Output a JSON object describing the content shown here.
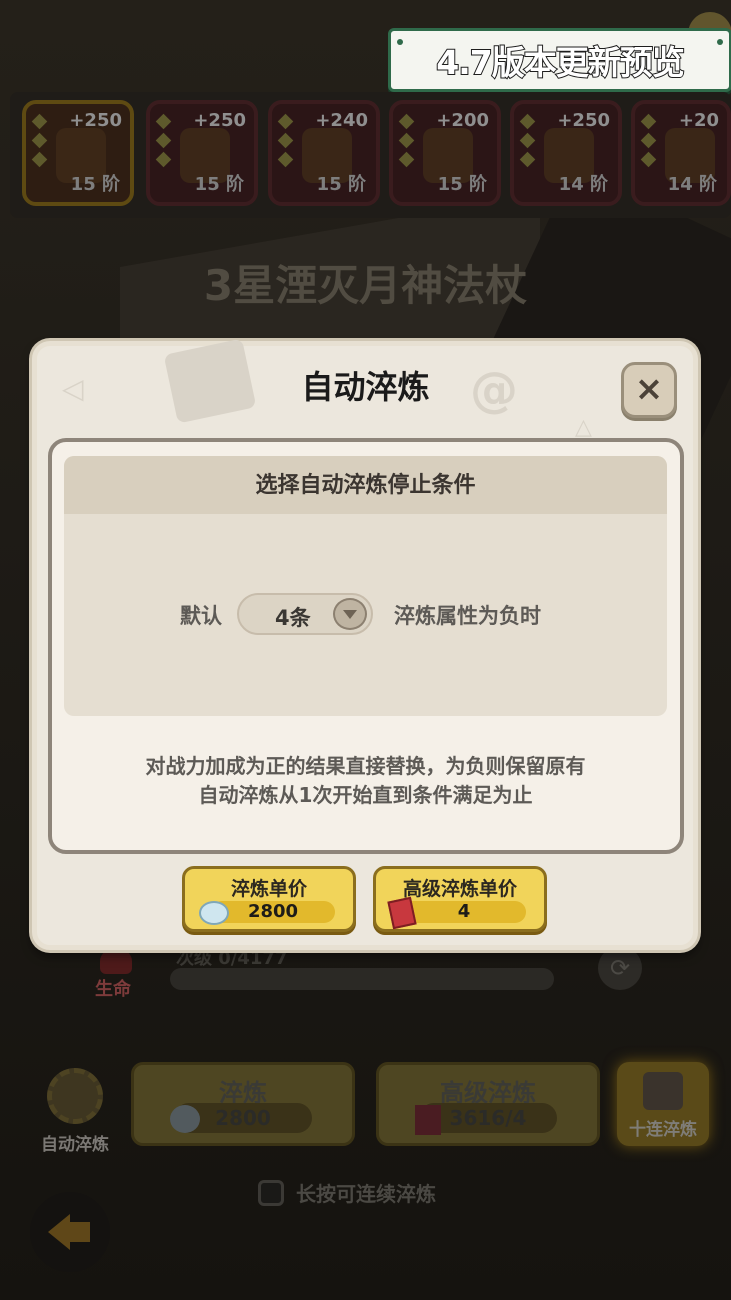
{
  "banner": {
    "text": "4.7版本更新预览"
  },
  "equipment_slots": [
    {
      "bonus": "+250",
      "tier": "15 阶",
      "selected": true
    },
    {
      "bonus": "+250",
      "tier": "15 阶",
      "selected": false
    },
    {
      "bonus": "+240",
      "tier": "15 阶",
      "selected": false
    },
    {
      "bonus": "+200",
      "tier": "15 阶",
      "selected": false
    },
    {
      "bonus": "+250",
      "tier": "14 阶",
      "selected": false
    },
    {
      "bonus": "+20",
      "tier": "14 阶",
      "selected": false
    }
  ],
  "weapon_name": "3星湮灭月神法杖",
  "background": {
    "life_label": "生命",
    "level_text": "次级 0/4177"
  },
  "modal": {
    "title": "自动淬炼",
    "close_icon": "×",
    "condition_header": "选择自动淬炼停止条件",
    "default_label": "默认",
    "dropdown_value": "4条",
    "condition_label": "淬炼属性为负时",
    "description_line1": "对战力加成为正的结果直接替换，为负则保留原有",
    "description_line2": "自动淬炼从1次开始直到条件满足为止",
    "unit_price": {
      "label": "淬炼单价",
      "value": "2800",
      "icon": "crystal-icon"
    },
    "advanced_unit_price": {
      "label": "高级淬炼单价",
      "value": "4",
      "icon": "ticket-icon"
    }
  },
  "bottom": {
    "auto_refine_label": "自动淬炼",
    "refine": {
      "label": "淬炼",
      "cost": "2800"
    },
    "advanced_refine": {
      "label": "高级淬炼",
      "cost": "3616/4"
    },
    "ten_refine_label": "十连淬炼",
    "hold_hint": "长按可连续淬炼"
  },
  "colors": {
    "modal_bg": "#ece7dd",
    "button_yellow": "#f1d45a",
    "banner_border": "#2f6a4a"
  }
}
